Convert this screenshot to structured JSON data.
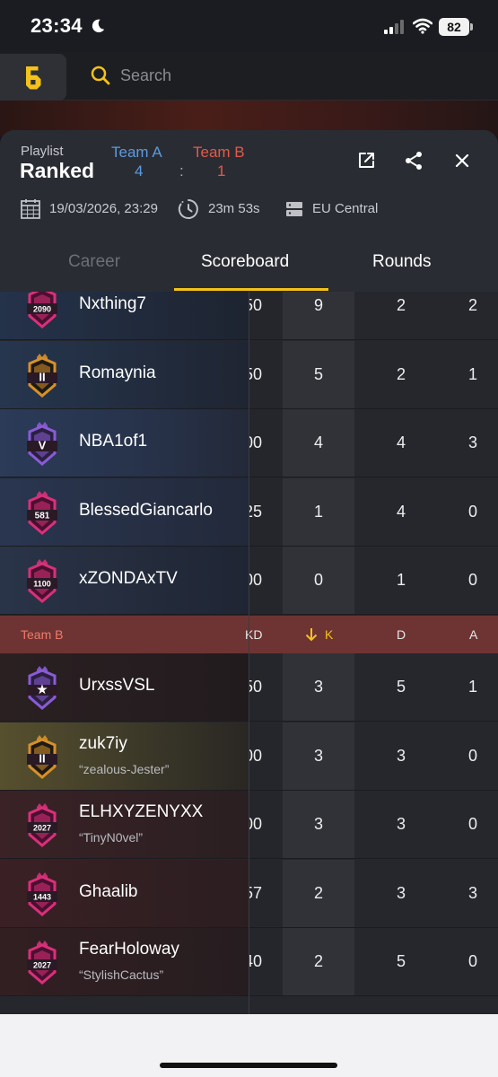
{
  "status_bar": {
    "time": "23:34",
    "battery": "82"
  },
  "search": {
    "placeholder": "Search"
  },
  "match": {
    "playlist_label": "Playlist",
    "playlist_value": "Ranked",
    "team_a_label": "Team A",
    "team_b_label": "Team B",
    "team_a_score": "4",
    "score_separator": ":",
    "team_b_score": "1",
    "date": "19/03/2026, 23:29",
    "duration": "23m 53s",
    "server": "EU Central"
  },
  "tabs": [
    {
      "label": "Career"
    },
    {
      "label": "Scoreboard"
    },
    {
      "label": "Rounds"
    }
  ],
  "team_a_rows": [
    {
      "name": "Nxthing7",
      "alias": "",
      "rank_badge": "2090",
      "kd": "50",
      "k": "9",
      "d": "2",
      "a": "2"
    },
    {
      "name": "Romaynia",
      "alias": "",
      "rank_badge": "II",
      "kd": "50",
      "k": "5",
      "d": "2",
      "a": "1"
    },
    {
      "name": "NBA1of1",
      "alias": "",
      "rank_badge": "V",
      "kd": "00",
      "k": "4",
      "d": "4",
      "a": "3"
    },
    {
      "name": "BlessedGiancarlo",
      "alias": "",
      "rank_badge": "581",
      "kd": "25",
      "k": "1",
      "d": "4",
      "a": "0"
    },
    {
      "name": "xZONDAxTV",
      "alias": "",
      "rank_badge": "1100",
      "kd": "00",
      "k": "0",
      "d": "1",
      "a": "0"
    }
  ],
  "team_b_header": {
    "name": "Team B",
    "kd": "KD",
    "k": "K",
    "d": "D",
    "a": "A"
  },
  "team_b_rows": [
    {
      "name": "UrxssVSL",
      "alias": "",
      "rank_badge": "★",
      "kd": "50",
      "k": "3",
      "d": "5",
      "a": "1"
    },
    {
      "name": "zuk7iy",
      "alias": "“zealous-Jester”",
      "rank_badge": "II",
      "kd": "00",
      "k": "3",
      "d": "3",
      "a": "0"
    },
    {
      "name": "ELHXYZENYXX",
      "alias": "“TinyN0vel”",
      "rank_badge": "2027",
      "kd": "00",
      "k": "3",
      "d": "3",
      "a": "0"
    },
    {
      "name": "Ghaalib",
      "alias": "",
      "rank_badge": "1443",
      "kd": "57",
      "k": "2",
      "d": "3",
      "a": "3"
    },
    {
      "name": "FearHoloway",
      "alias": "“StylishCactus”",
      "rank_badge": "2027",
      "kd": "40",
      "k": "2",
      "d": "5",
      "a": "0"
    }
  ],
  "colors": {
    "accent": "#f4c21a",
    "team_a": "#5b9be0",
    "team_b": "#e25a4a",
    "badge_pink": "#d9307a",
    "badge_gold": "#d7902a",
    "badge_purple": "#8a5bd6"
  }
}
